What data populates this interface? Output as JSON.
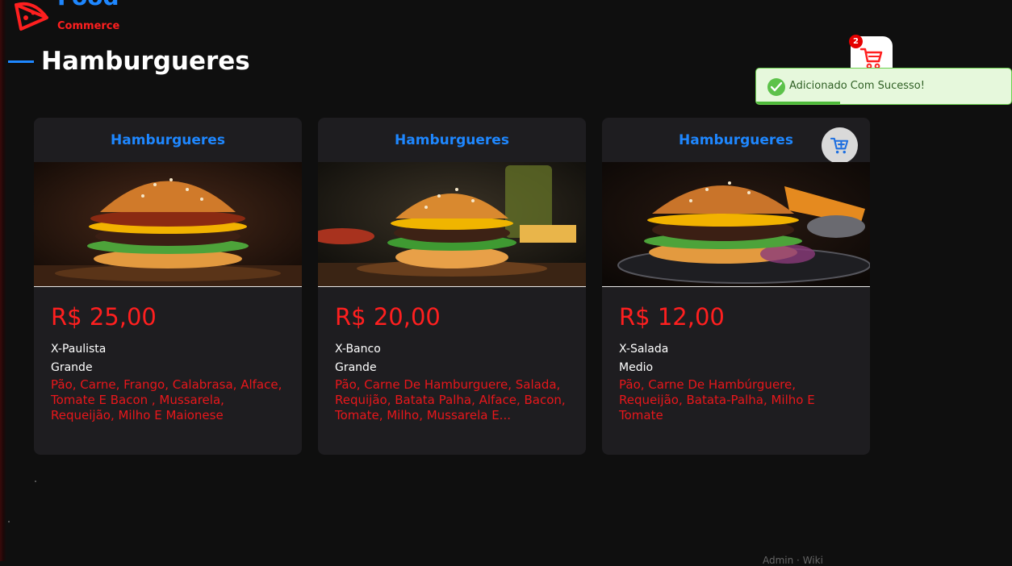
{
  "brand": {
    "name": "Food",
    "sub": "Commerce",
    "accent": "#1e87ff",
    "secondary": "#ff1f1f"
  },
  "page": {
    "title": "Hamburgueres"
  },
  "cart": {
    "count": "2",
    "icon": "shopping-cart-icon"
  },
  "toast": {
    "message": "Adicionado Com Sucesso!",
    "icon": "check-circle-icon",
    "progress": 0.33
  },
  "products": [
    {
      "category": "Hamburgueres",
      "price": "R$ 25,00",
      "name": "X-Paulista",
      "size": "Grande",
      "description": "Pão, Carne, Frango, Calabrasa, Alface, Tomate E Bacon , Mussarela, Requeijão, Milho E Maionese"
    },
    {
      "category": "Hamburgueres",
      "price": "R$ 20,00",
      "name": "X-Banco",
      "size": "Grande",
      "description": "Pão, Carne De Hamburguere, Salada, Requijão, Batata Palha, Alface, Bacon, Tomate, Milho, Mussarela E..."
    },
    {
      "category": "Hamburgueres",
      "price": "R$ 12,00",
      "name": "X-Salada",
      "size": "Medio",
      "description": "Pão, Carne De Hambúrguere, Requeijão, Batata-Palha, Milho E Tomate"
    }
  ],
  "footer": {
    "partial": "Admin · Wiki"
  }
}
